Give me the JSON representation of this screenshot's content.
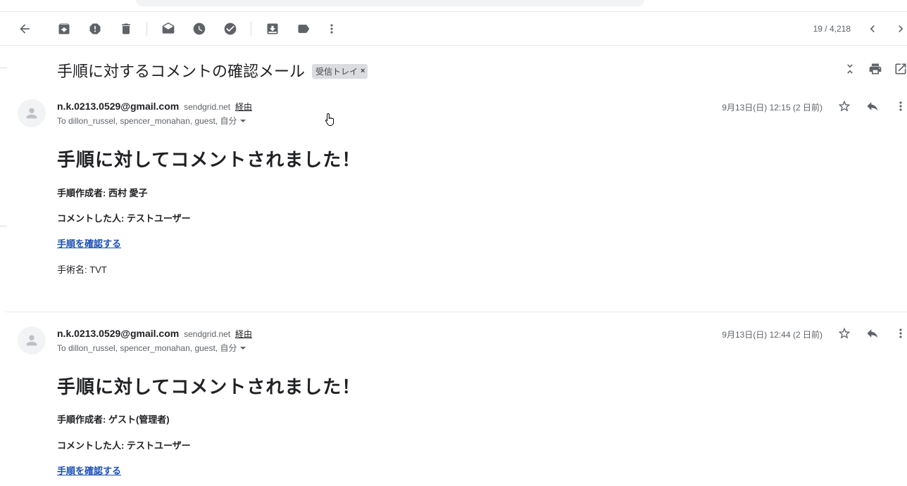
{
  "toolbar": {
    "icons": [
      "back-arrow-icon",
      "archive-icon",
      "report-spam-icon",
      "delete-icon",
      "mark-unread-icon",
      "snooze-icon",
      "add-task-icon",
      "move-to-icon",
      "label-icon",
      "more-vert-icon"
    ],
    "pager": "19 / 4,218"
  },
  "thread": {
    "subject": "手順に対するコメントの確認メール",
    "label": "受信トレイ",
    "label_close": "×"
  },
  "messages": [
    {
      "email": "n.k.0213.0529@gmail.com",
      "domain": "sendgrid.net",
      "via": "経由",
      "recipients": "To dillon_russel, spencer_monahan, guest, 自分",
      "date": "9月13日(日) 12:15 (2 日前)",
      "title": "手順に対してコメントされました！",
      "author": "手順作成者: 西村 愛子",
      "commenter": "コメントした人: テストユーザー",
      "link": "手順を確認する",
      "procedure": "手術名: TVT"
    },
    {
      "email": "n.k.0213.0529@gmail.com",
      "domain": "sendgrid.net",
      "via": "経由",
      "recipients": "To dillon_russel, spencer_monahan, guest, 自分",
      "date": "9月13日(日) 12:44 (2 日前)",
      "title": "手順に対してコメントされました！",
      "author": "手順作成者: ゲスト(管理者)",
      "commenter": "コメントした人: テストユーザー",
      "link": "手順を確認する"
    }
  ]
}
